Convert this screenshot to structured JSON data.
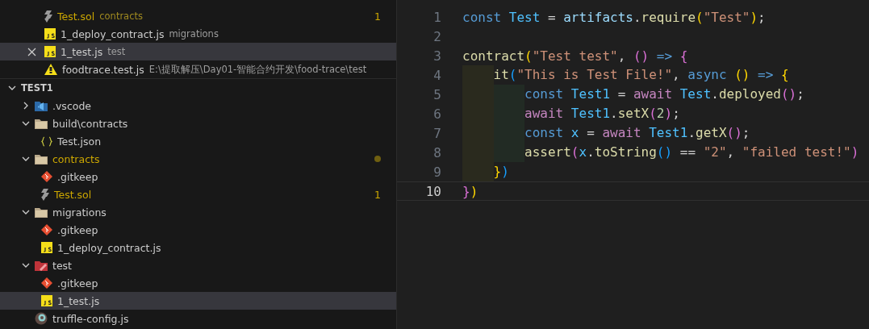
{
  "open_editors": [
    {
      "name": "Test.sol",
      "description": "contracts",
      "kind": "sol",
      "warning": true,
      "badge": "1",
      "selected": false
    },
    {
      "name": "1_deploy_contract.js",
      "description": "migrations",
      "kind": "js",
      "warning": false,
      "selected": false
    },
    {
      "name": "1_test.js",
      "description": "test",
      "kind": "js",
      "warning": false,
      "selected": true
    },
    {
      "name": "foodtrace.test.js",
      "description": "E:\\提取解压\\Day01-智能合约开发\\food-trace\\test",
      "kind": "js-alert",
      "warning": false,
      "selected": false
    }
  ],
  "explorer": {
    "title": "TEST1",
    "expanded": true,
    "items": [
      {
        "name": ".vscode",
        "kind": "vscode-folder",
        "expanded": false,
        "selected": false,
        "warning": false
      },
      {
        "name": "build\\contracts",
        "kind": "folder",
        "expanded": true,
        "selected": false,
        "warning": false,
        "children": [
          {
            "name": "Test.json",
            "kind": "json",
            "selected": false,
            "warning": false
          }
        ]
      },
      {
        "name": "contracts",
        "kind": "folder",
        "expanded": true,
        "selected": false,
        "warning": true,
        "dot": true,
        "children": [
          {
            "name": ".gitkeep",
            "kind": "git",
            "selected": false,
            "warning": false
          },
          {
            "name": "Test.sol",
            "kind": "sol",
            "selected": false,
            "warning": true,
            "badge": "1"
          }
        ]
      },
      {
        "name": "migrations",
        "kind": "folder",
        "expanded": true,
        "selected": false,
        "warning": false,
        "children": [
          {
            "name": ".gitkeep",
            "kind": "git",
            "selected": false,
            "warning": false
          },
          {
            "name": "1_deploy_contract.js",
            "kind": "js",
            "selected": false,
            "warning": false
          }
        ]
      },
      {
        "name": "test",
        "kind": "test-folder",
        "expanded": true,
        "selected": false,
        "warning": false,
        "children": [
          {
            "name": ".gitkeep",
            "kind": "git",
            "selected": false,
            "warning": false
          },
          {
            "name": "1_test.js",
            "kind": "js",
            "selected": true,
            "warning": false
          }
        ]
      },
      {
        "name": "truffle-config.js",
        "kind": "truffle",
        "selected": false,
        "warning": false
      }
    ]
  },
  "editor": {
    "lines": [
      {
        "number": "1",
        "current": false,
        "tokens": [
          {
            "kind": "keyword",
            "text": "const "
          },
          {
            "kind": "constant",
            "text": "Test"
          },
          {
            "kind": "plain",
            "text": " = "
          },
          {
            "kind": "variable",
            "text": "artifacts"
          },
          {
            "kind": "plain",
            "text": "."
          },
          {
            "kind": "function",
            "text": "require"
          },
          {
            "kind": "bracket1",
            "text": "("
          },
          {
            "kind": "string",
            "text": "\"Test\""
          },
          {
            "kind": "bracket1",
            "text": ")"
          },
          {
            "kind": "plain",
            "text": ";"
          }
        ]
      },
      {
        "number": "2",
        "current": false
      },
      {
        "number": "3",
        "current": false,
        "tokens": [
          {
            "kind": "function",
            "text": "contract"
          },
          {
            "kind": "bracket1",
            "text": "("
          },
          {
            "kind": "string",
            "text": "\"Test test\""
          },
          {
            "kind": "plain",
            "text": ", "
          },
          {
            "kind": "bracket2",
            "text": "()"
          },
          {
            "kind": "keyword",
            "text": " => "
          },
          {
            "kind": "bracket2",
            "text": "{"
          }
        ]
      },
      {
        "number": "4",
        "current": false,
        "tokens": [
          {
            "kind": "function",
            "text": "    it"
          },
          {
            "kind": "bracket3",
            "text": "("
          },
          {
            "kind": "string",
            "text": "\"This is Test File!\""
          },
          {
            "kind": "plain",
            "text": ", "
          },
          {
            "kind": "keyword",
            "text": "async "
          },
          {
            "kind": "bracket1",
            "text": "()"
          },
          {
            "kind": "keyword",
            "text": " => "
          },
          {
            "kind": "bracket1",
            "text": "{"
          }
        ]
      },
      {
        "number": "5",
        "current": false,
        "tokens": [
          {
            "kind": "keyword",
            "text": "        const "
          },
          {
            "kind": "constant",
            "text": "Test1"
          },
          {
            "kind": "plain",
            "text": " = "
          },
          {
            "kind": "control",
            "text": "await "
          },
          {
            "kind": "constant",
            "text": "Test"
          },
          {
            "kind": "plain",
            "text": "."
          },
          {
            "kind": "function",
            "text": "deployed"
          },
          {
            "kind": "bracket2",
            "text": "()"
          },
          {
            "kind": "plain",
            "text": ";"
          }
        ]
      },
      {
        "number": "6",
        "current": false,
        "tokens": [
          {
            "kind": "control",
            "text": "        await "
          },
          {
            "kind": "constant",
            "text": "Test1"
          },
          {
            "kind": "plain",
            "text": "."
          },
          {
            "kind": "function",
            "text": "setX"
          },
          {
            "kind": "bracket2",
            "text": "("
          },
          {
            "kind": "number",
            "text": "2"
          },
          {
            "kind": "bracket2",
            "text": ")"
          },
          {
            "kind": "plain",
            "text": ";"
          }
        ]
      },
      {
        "number": "7",
        "current": false,
        "tokens": [
          {
            "kind": "keyword",
            "text": "        const "
          },
          {
            "kind": "constant",
            "text": "x"
          },
          {
            "kind": "plain",
            "text": " = "
          },
          {
            "kind": "control",
            "text": "await "
          },
          {
            "kind": "constant",
            "text": "Test1"
          },
          {
            "kind": "plain",
            "text": "."
          },
          {
            "kind": "function",
            "text": "getX"
          },
          {
            "kind": "bracket2",
            "text": "()"
          },
          {
            "kind": "plain",
            "text": ";"
          }
        ]
      },
      {
        "number": "8",
        "current": false,
        "tokens": [
          {
            "kind": "function",
            "text": "        assert"
          },
          {
            "kind": "bracket2",
            "text": "("
          },
          {
            "kind": "constant",
            "text": "x"
          },
          {
            "kind": "plain",
            "text": "."
          },
          {
            "kind": "function",
            "text": "toString"
          },
          {
            "kind": "bracket3",
            "text": "()"
          },
          {
            "kind": "plain",
            "text": " == "
          },
          {
            "kind": "string",
            "text": "\"2\""
          },
          {
            "kind": "plain",
            "text": ", "
          },
          {
            "kind": "string",
            "text": "\"failed test!\""
          },
          {
            "kind": "bracket2",
            "text": ")"
          }
        ]
      },
      {
        "number": "9",
        "current": false,
        "tokens": [
          {
            "kind": "bracket1",
            "text": "    }"
          },
          {
            "kind": "bracket3",
            "text": ")"
          }
        ]
      },
      {
        "number": "10",
        "current": true,
        "tokens": [
          {
            "kind": "bracket2",
            "text": "}"
          },
          {
            "kind": "bracket1",
            "text": ")"
          }
        ]
      }
    ]
  }
}
